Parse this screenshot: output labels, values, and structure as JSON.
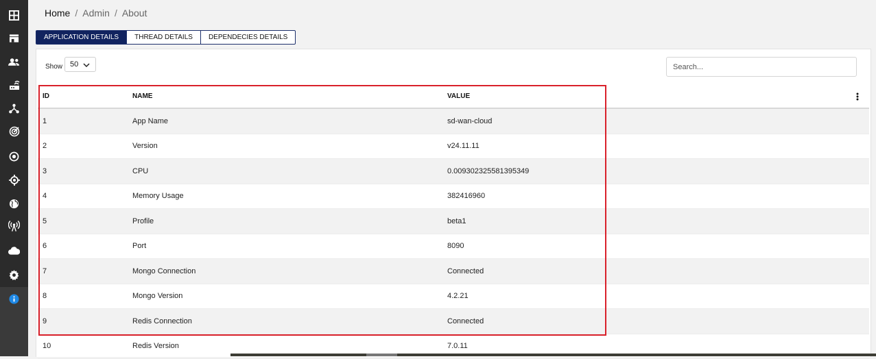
{
  "breadcrumb": {
    "home": "Home",
    "admin": "Admin",
    "current": "About",
    "separator": "/"
  },
  "tabs": [
    {
      "label": "APPLICATION DETAILS",
      "active": true
    },
    {
      "label": "THREAD DETAILS",
      "active": false
    },
    {
      "label": "DEPENDECIES DETAILS",
      "active": false
    }
  ],
  "controls": {
    "show_label": "Show",
    "show_value": "50",
    "search_placeholder": "Search..."
  },
  "table": {
    "headers": {
      "id": "ID",
      "name": "NAME",
      "value": "VALUE"
    },
    "rows": [
      {
        "id": "1",
        "name": "App Name",
        "value": "sd-wan-cloud"
      },
      {
        "id": "2",
        "name": "Version",
        "value": "v24.11.11"
      },
      {
        "id": "3",
        "name": "CPU",
        "value": "0.009302325581395349"
      },
      {
        "id": "4",
        "name": "Memory Usage",
        "value": "382416960"
      },
      {
        "id": "5",
        "name": "Profile",
        "value": "beta1"
      },
      {
        "id": "6",
        "name": "Port",
        "value": "8090"
      },
      {
        "id": "7",
        "name": "Mongo Connection",
        "value": "Connected"
      },
      {
        "id": "8",
        "name": "Mongo Version",
        "value": "4.2.21"
      },
      {
        "id": "9",
        "name": "Redis Connection",
        "value": "Connected"
      },
      {
        "id": "10",
        "name": "Redis Version",
        "value": "7.0.11"
      }
    ]
  },
  "sidebar": {
    "icons": [
      "dashboard-icon",
      "store-icon",
      "users-icon",
      "router-icon",
      "topology-icon",
      "radar-icon",
      "target-icon",
      "location-icon",
      "globe-icon",
      "antenna-icon",
      "cloud-icon",
      "gear-icon",
      "info-icon"
    ],
    "active_icon": "info-icon"
  },
  "colors": {
    "accent": "#11235f",
    "highlight": "#d9202a",
    "sidebar": "#2b2b2b",
    "info": "#1e88e5"
  }
}
